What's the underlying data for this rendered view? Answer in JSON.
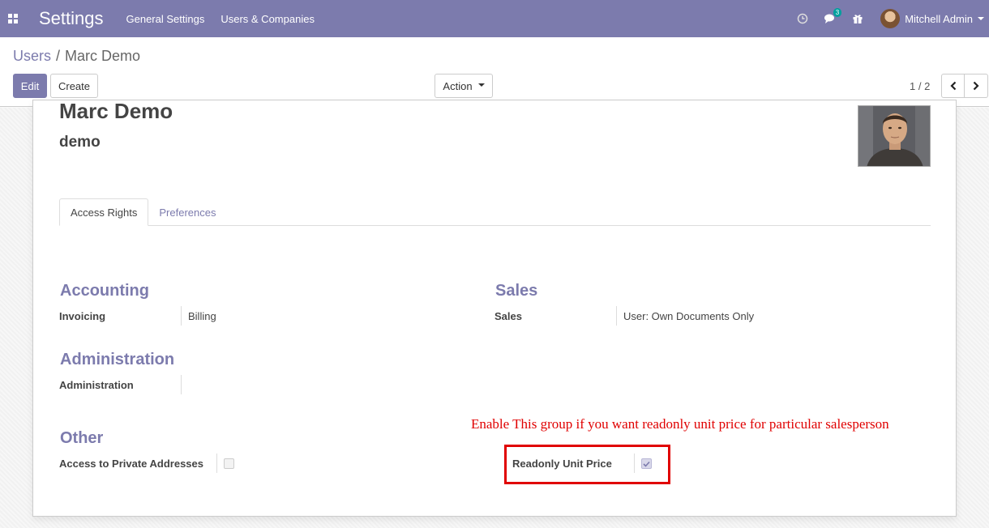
{
  "navbar": {
    "app_title": "Settings",
    "menu": [
      "General Settings",
      "Users & Companies"
    ],
    "chat_badge": "3",
    "user_name": "Mitchell Admin",
    "icons": [
      "apps-icon",
      "clock-icon",
      "chat-icon",
      "gift-icon"
    ]
  },
  "breadcrumb": {
    "parent": "Users",
    "separator": "/",
    "current": "Marc Demo"
  },
  "toolbar": {
    "edit_label": "Edit",
    "create_label": "Create",
    "action_label": "Action",
    "pager": "1 / 2"
  },
  "record": {
    "name": "Marc Demo",
    "login": "demo"
  },
  "tabs": [
    "Access Rights",
    "Preferences"
  ],
  "groups": {
    "accounting": {
      "title": "Accounting",
      "field_label": "Invoicing",
      "field_value": "Billing"
    },
    "sales": {
      "title": "Sales",
      "field_label": "Sales",
      "field_value": "User: Own Documents Only"
    },
    "administration": {
      "title": "Administration",
      "field_label": "Administration",
      "field_value": ""
    },
    "other": {
      "title": "Other",
      "private_label": "Access to Private Addresses",
      "private_checked": false,
      "readonly_label": "Readonly Unit Price",
      "readonly_checked": true
    }
  },
  "annotation": {
    "text": "Enable This group if you want readonly unit price for particular salesperson",
    "color": "#e00000"
  },
  "colors": {
    "brand": "#7c7bad",
    "badge": "#00a09d"
  }
}
